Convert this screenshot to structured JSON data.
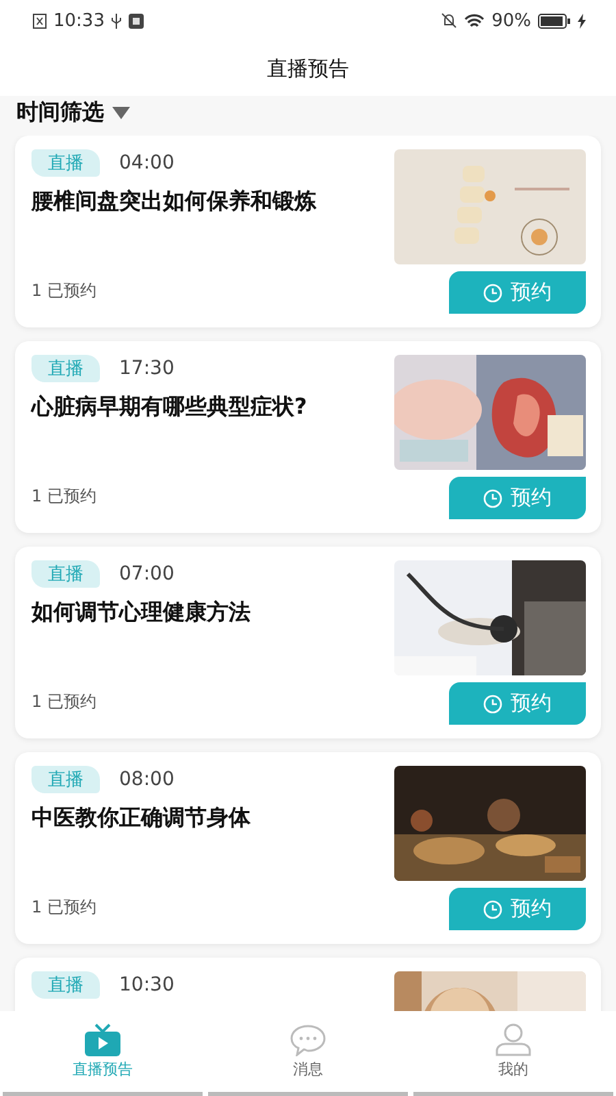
{
  "status_bar": {
    "time": "10:33",
    "battery": "90%"
  },
  "header": {
    "title": "直播预告"
  },
  "filter": {
    "label": "时间筛选"
  },
  "events": [
    {
      "tag": "直播",
      "time": "04:00",
      "title": "腰椎间盘突出如何保养和锻炼",
      "booked": "1 已预约",
      "button": "预约"
    },
    {
      "tag": "直播",
      "time": "17:30",
      "title": "心脏病早期有哪些典型症状?",
      "booked": "1 已预约",
      "button": "预约"
    },
    {
      "tag": "直播",
      "time": "07:00",
      "title": "如何调节心理健康方法",
      "booked": "1 已预约",
      "button": "预约"
    },
    {
      "tag": "直播",
      "time": "08:00",
      "title": "中医教你正确调节身体",
      "booked": "1 已预约",
      "button": "预约"
    },
    {
      "tag": "直播",
      "time": "10:30"
    }
  ],
  "tabs": [
    {
      "label": "直播预告",
      "selected": true,
      "kind": "tv"
    },
    {
      "label": "消息",
      "selected": false,
      "kind": "chat"
    },
    {
      "label": "我的",
      "selected": false,
      "kind": "person"
    }
  ]
}
